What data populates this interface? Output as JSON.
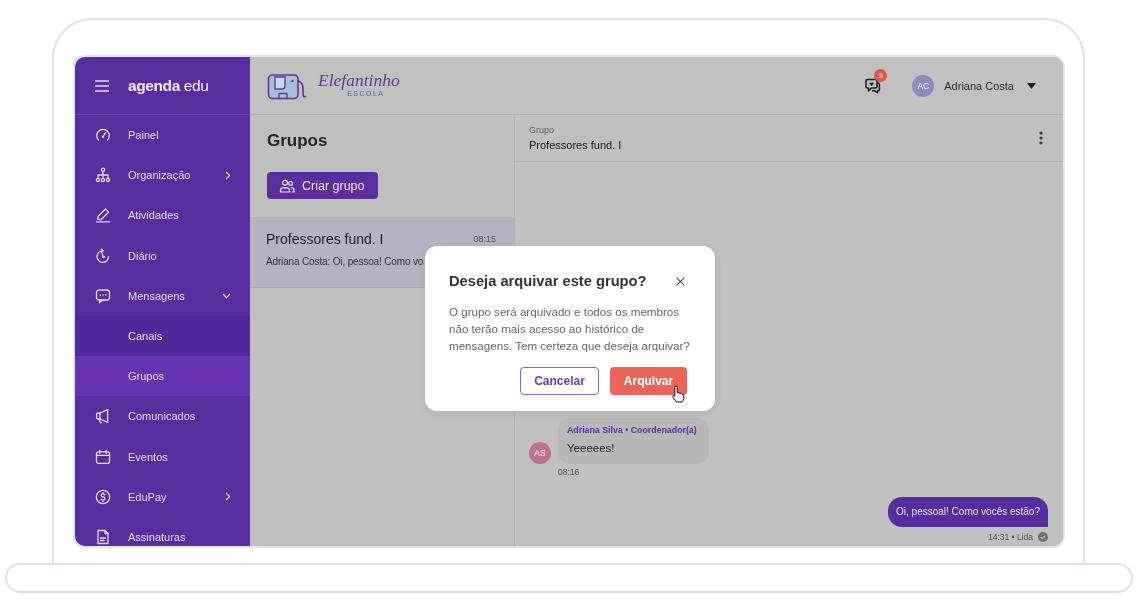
{
  "sidebar": {
    "logo": "**agenda** edu",
    "items": [
      {
        "label": "Painel",
        "kind": "link",
        "selected": false
      },
      {
        "label": "Organização",
        "kind": "group",
        "expanded": false,
        "selected": false
      },
      {
        "label": "Atividades",
        "kind": "link",
        "selected": false
      },
      {
        "label": "Diário",
        "kind": "link",
        "selected": false
      },
      {
        "label": "Mensagens",
        "kind": "group",
        "expanded": true,
        "selected": false,
        "children": [
          {
            "label": "Canais",
            "selected": false
          },
          {
            "label": "Grupos",
            "selected": true
          }
        ]
      },
      {
        "label": "Comunicados",
        "kind": "link",
        "selected": false
      },
      {
        "label": "Eventos",
        "kind": "link",
        "selected": false
      },
      {
        "label": "EduPay",
        "kind": "group",
        "expanded": false,
        "selected": false
      },
      {
        "label": "Assinaturas",
        "kind": "link",
        "selected": false
      }
    ]
  },
  "header": {
    "brand": "Elefantinho",
    "brand_subtitle": "ESCOLA",
    "notifications": {
      "badge": "3"
    },
    "user": {
      "initials": "AC",
      "name": "Adriana Costa"
    }
  },
  "groups_panel": {
    "title": "Grupos",
    "create_button": "Criar grupo",
    "groups": [
      {
        "name": "Professores fund. I",
        "time": "08:15",
        "preview": "Adriana Costa: Oi, pessoa! Como vo",
        "selected": true
      }
    ]
  },
  "chat": {
    "caption": "Grupo",
    "title": "Professores fund. I",
    "messages": [
      {
        "kind": "incoming",
        "initials": "AS",
        "sender": "Adriana Silva • Coordenador(a)",
        "text": "Yeeeees!",
        "time": "08:16"
      },
      {
        "kind": "outgoing",
        "text": "Oi, pessoal! Como vocês estão?",
        "meta": "14:31 • Lida"
      }
    ]
  },
  "dialog": {
    "title": "Deseja arquivar este grupo?",
    "body": "O grupo será arquivado e todos os membros não terão mais acesso ao histórico de mensagens. Tem certeza que deseja arquivar?",
    "buttons": [
      {
        "label": "Cancelar",
        "kind": "secondary"
      },
      {
        "label": "Arquivar",
        "kind": "danger"
      }
    ]
  }
}
